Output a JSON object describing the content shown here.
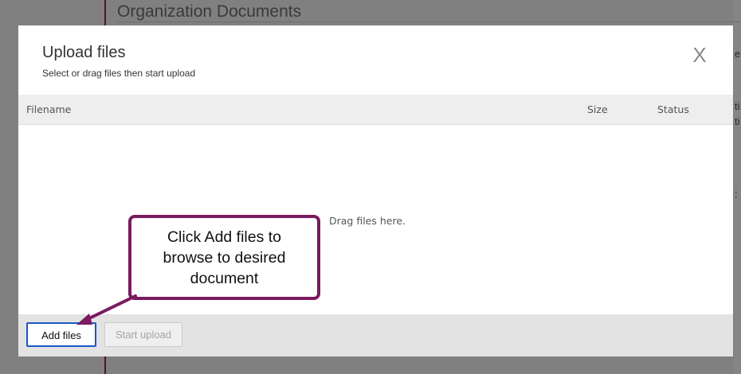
{
  "background": {
    "page_title": "Organization Documents",
    "right_fragments": [
      "e",
      "ti",
      "ti",
      ":"
    ]
  },
  "modal": {
    "title": "Upload files",
    "subtitle": "Select or drag files then start upload",
    "close_glyph": "X",
    "table": {
      "columns": [
        "Filename",
        "Size",
        "Status"
      ]
    },
    "drop_text": "Drag files here.",
    "buttons": {
      "add_files": "Add files",
      "start_upload": "Start upload"
    }
  },
  "callout": {
    "text": "Click Add files to\nbrowse to desired\ndocument",
    "border_color": "#7b1a5e"
  },
  "colors": {
    "accent_focus": "#1a56c6",
    "overlay": "#808080"
  }
}
